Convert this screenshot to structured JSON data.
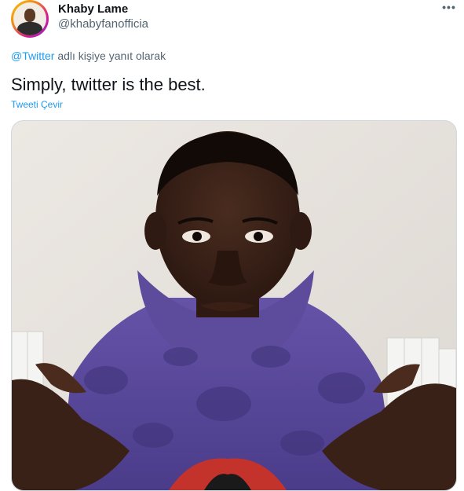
{
  "tweet": {
    "display_name": "Khaby Lame",
    "handle": "@khabyfanofficia",
    "reply_mention": "@Twitter",
    "reply_suffix": "adlı kişiye yanıt olarak",
    "text": "Simply, twitter is the best.",
    "translate_label": "Tweeti Çevir",
    "more_icon": "more-horizontal-icon"
  },
  "colors": {
    "link": "#1d9bf0",
    "secondary_text": "#536471",
    "primary_text": "#0f1419",
    "hoodie": "#5b4a9e",
    "skin": "#3b2218",
    "wall": "#e9e5e0"
  }
}
